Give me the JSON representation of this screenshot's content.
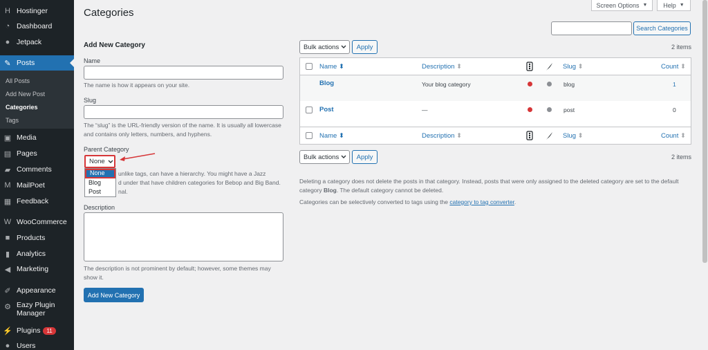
{
  "sidebar": {
    "items": [
      {
        "label": "Hostinger",
        "icon": "hostinger-icon"
      },
      {
        "label": "Dashboard",
        "icon": "dashboard-icon"
      },
      {
        "label": "Jetpack",
        "icon": "jetpack-icon"
      },
      {
        "label": "Posts",
        "icon": "pin-icon"
      },
      {
        "label": "Media",
        "icon": "media-icon"
      },
      {
        "label": "Pages",
        "icon": "pages-icon"
      },
      {
        "label": "Comments",
        "icon": "comments-icon"
      },
      {
        "label": "MailPoet",
        "icon": "mailpoet-icon"
      },
      {
        "label": "Feedback",
        "icon": "feedback-icon"
      },
      {
        "label": "WooCommerce",
        "icon": "woocommerce-icon"
      },
      {
        "label": "Products",
        "icon": "products-icon"
      },
      {
        "label": "Analytics",
        "icon": "analytics-icon"
      },
      {
        "label": "Marketing",
        "icon": "marketing-icon"
      },
      {
        "label": "Appearance",
        "icon": "appearance-icon"
      },
      {
        "label": "Eazy Plugin",
        "label2": "Manager",
        "icon": "plugin-manager-icon"
      },
      {
        "label": "Plugins",
        "icon": "plugins-icon",
        "badge": "11"
      },
      {
        "label": "Users",
        "icon": "users-icon"
      }
    ],
    "submenu": [
      "All Posts",
      "Add New Post",
      "Categories",
      "Tags"
    ]
  },
  "top": {
    "screen_options": "Screen Options",
    "help": "Help"
  },
  "page_title": "Categories",
  "search": {
    "button": "Search Categories"
  },
  "form": {
    "title": "Add New Category",
    "name_label": "Name",
    "name_help": "The name is how it appears on your site.",
    "slug_label": "Slug",
    "slug_help_1": "The “slug” is the URL-friendly version of the name. It is usually all lowercase",
    "slug_help_2": "and contains only letters, numbers, and hyphens.",
    "parent_label": "Parent Category",
    "parent_value": "None",
    "parent_options": [
      "None",
      "Blog",
      "Post"
    ],
    "parent_help_1": "unlike tags, can have a hierarchy. You might have a Jazz",
    "parent_help_2": "d under that have children categories for Bebop and Big Band.",
    "parent_help_3": "nal.",
    "description_label": "Description",
    "description_help_1": "The description is not prominent by default; however, some themes may",
    "description_help_2": "show it.",
    "submit": "Add New Category"
  },
  "table": {
    "bulk_actions": "Bulk actions",
    "apply": "Apply",
    "items_count": "2 items",
    "columns": {
      "name": "Name",
      "description": "Description",
      "slug": "Slug",
      "count": "Count"
    },
    "rows": [
      {
        "name": "Blog",
        "description": "Your blog category",
        "slug": "blog",
        "count": "1"
      },
      {
        "name": "Post",
        "description": "—",
        "slug": "post",
        "count": "0"
      }
    ]
  },
  "notes": {
    "line1": "Deleting a category does not delete the posts in that category. Instead, posts that were only assigned to the deleted category are set to the default",
    "line2_pre": "category ",
    "line2_bold": "Blog",
    "line2_post": ". The default category cannot be deleted.",
    "line3_pre": "Categories can be selectively converted to tags using the ",
    "line3_link": "category to tag converter",
    "line3_post": "."
  },
  "colors": {
    "accent": "#2271b1",
    "sidebar": "#1d2327",
    "danger": "#d63638"
  }
}
